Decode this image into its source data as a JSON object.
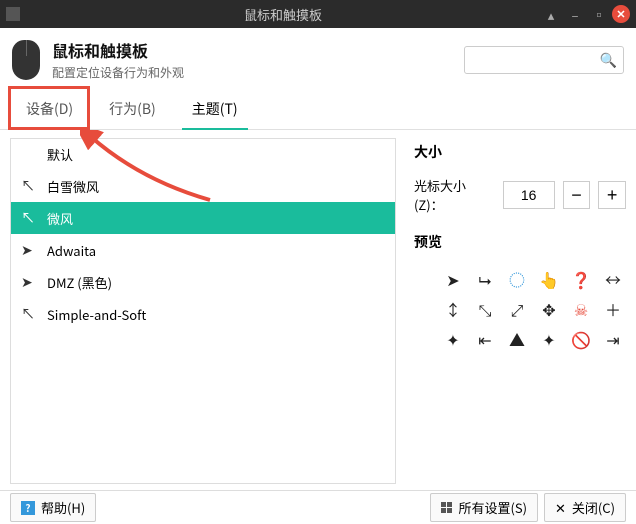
{
  "window": {
    "title": "鼠标和触摸板"
  },
  "header": {
    "title": "鼠标和触摸板",
    "subtitle": "配置定位设备行为和外观"
  },
  "search": {
    "placeholder": ""
  },
  "tabs": {
    "devices": "设备(D)",
    "behavior": "行为(B)",
    "theme": "主题(T)"
  },
  "themes": [
    {
      "name": "默认",
      "selected": false
    },
    {
      "name": "白雪微风",
      "selected": false
    },
    {
      "name": "微风",
      "selected": true
    },
    {
      "name": "Adwaita",
      "selected": false
    },
    {
      "name": "DMZ (黑色)",
      "selected": false
    },
    {
      "name": "Simple-and-Soft",
      "selected": false
    }
  ],
  "size": {
    "section": "大小",
    "label": "光标大小(Z)：",
    "value": "16"
  },
  "preview": {
    "section": "预览"
  },
  "footer": {
    "help": "帮助(H)",
    "all_settings": "所有设置(S)",
    "close": "关闭(C)"
  }
}
